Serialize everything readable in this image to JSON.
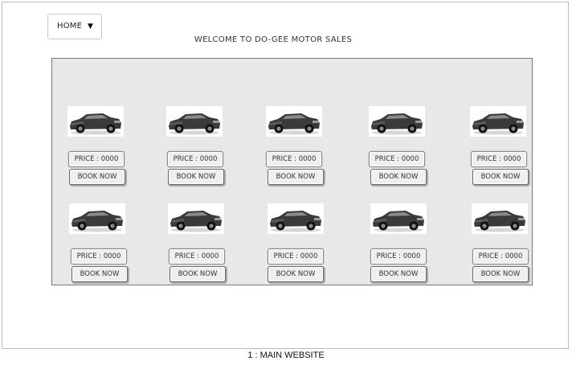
{
  "nav": {
    "dropdown_label": "HOME"
  },
  "header": {
    "welcome": "WELCOME TO DO-GEE MOTOR SALES"
  },
  "listings": [
    {
      "price_label": "PRICE : 0000",
      "book_label": "BOOK NOW"
    },
    {
      "price_label": "PRICE : 0000",
      "book_label": "BOOK NOW"
    },
    {
      "price_label": "PRICE : 0000",
      "book_label": "BOOK NOW"
    },
    {
      "price_label": "PRICE : 0000",
      "book_label": "BOOK NOW"
    },
    {
      "price_label": "PRICE : 0000",
      "book_label": "BOOK NOW"
    },
    {
      "price_label": "PRICE : 0000",
      "book_label": "BOOK NOW"
    },
    {
      "price_label": "PRICE : 0000",
      "book_label": "BOOK NOW"
    },
    {
      "price_label": "PRICE : 0000",
      "book_label": "BOOK NOW"
    },
    {
      "price_label": "PRICE : 0000",
      "book_label": "BOOK NOW"
    },
    {
      "price_label": "PRICE : 0000",
      "book_label": "BOOK NOW"
    }
  ],
  "footer": {
    "caption": "1 : MAIN WEBSITE"
  },
  "icons": {
    "dropdown": "caret-down-icon",
    "car": "car-image"
  },
  "colors": {
    "panel_bg": "#e8e8e8",
    "car_body": "#3a3a3a"
  }
}
